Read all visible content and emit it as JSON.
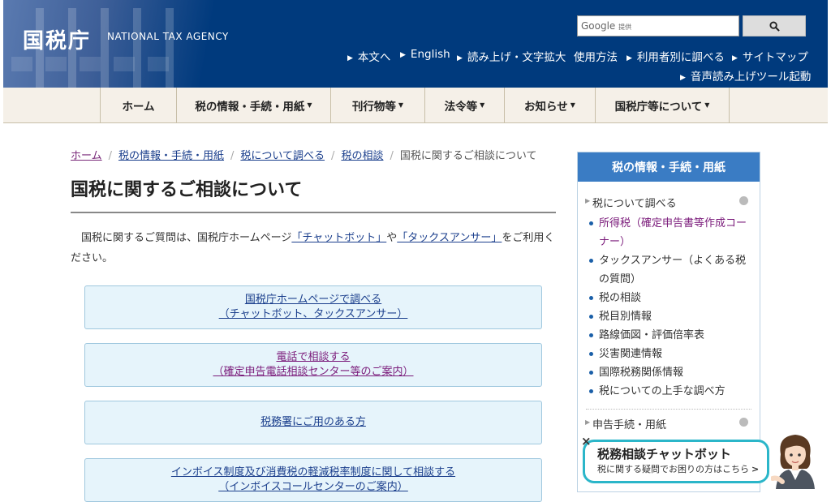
{
  "header": {
    "logo": "国税庁",
    "logo_en": "NATIONAL TAX AGENCY",
    "search": {
      "provider": "Google",
      "provided": "提供",
      "placeholder": ""
    },
    "util_links": [
      "本文へ",
      "English",
      "読み上げ・文字拡大",
      "使用方法",
      "利用者別に調べる",
      "サイトマップ",
      "音声読み上げツール起動"
    ]
  },
  "nav": [
    "ホーム",
    "税の情報・手続・用紙",
    "刊行物等",
    "法令等",
    "お知らせ",
    "国税庁等について"
  ],
  "breadcrumb": [
    "ホーム",
    "税の情報・手続・用紙",
    "税について調べる",
    "税の相談",
    "国税に関するご相談について"
  ],
  "page": {
    "title": "国税に関するご相談について",
    "intro_prefix": "国税に関するご質問は、国税庁ホームページ",
    "intro_link1": "「チャットボット」",
    "intro_mid": "や",
    "intro_link2": "「タックスアンサー」",
    "intro_suffix": "をご利用ください。"
  },
  "cards": [
    {
      "line1": "国税庁ホームページで調べる",
      "line2": "（チャットボット、タックスアンサー）"
    },
    {
      "line1": "電話で相談する",
      "line2": "（確定申告電話相談センター等のご案内）"
    },
    {
      "line1": "税務署にご用のある方",
      "line2": ""
    },
    {
      "line1": "インボイス制度及び消費税の軽減税率制度に関して相談する",
      "line2": "（インボイスコールセンターのご案内）"
    }
  ],
  "sidebar": {
    "title": "税の情報・手続・用紙",
    "section1": "税について調べる",
    "items": [
      "所得税（確定申告書等作成コーナー）",
      "タックスアンサー（よくある税の質問）",
      "税の相談",
      "税目別情報",
      "路線価図・評価倍率表",
      "災害関連情報",
      "国際税務関係情報",
      "税についての上手な調べ方"
    ],
    "section2": "申告手続・用紙"
  },
  "chatbot": {
    "close": "×",
    "title": "税務相談チャットボット",
    "subtitle": "税に関する疑問でお困りの方はこちら"
  },
  "colors": {
    "header": "#003a7d",
    "nav_bg": "#f5f0e8",
    "card_bg": "#e6f4fb",
    "sidebar_head": "#3a7cc4",
    "chat_border": "#2bb6c9"
  }
}
